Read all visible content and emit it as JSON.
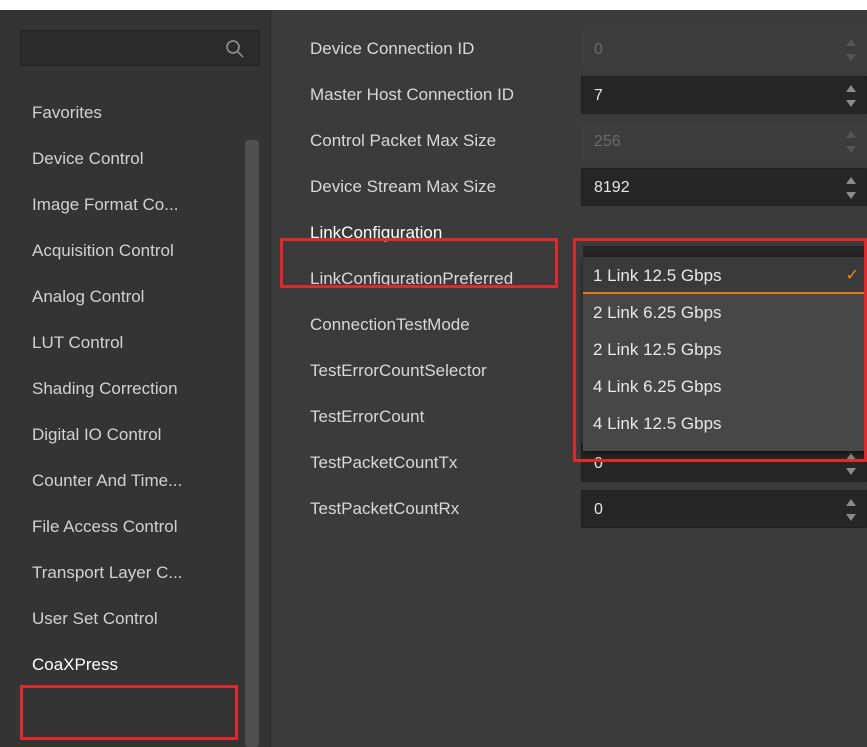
{
  "search": {
    "placeholder": ""
  },
  "sidebar": {
    "items": [
      {
        "label": "Favorites"
      },
      {
        "label": "Device Control"
      },
      {
        "label": "Image Format Co..."
      },
      {
        "label": "Acquisition Control"
      },
      {
        "label": "Analog Control"
      },
      {
        "label": "LUT Control"
      },
      {
        "label": "Shading Correction"
      },
      {
        "label": "Digital IO Control"
      },
      {
        "label": "Counter And Time..."
      },
      {
        "label": "File Access Control"
      },
      {
        "label": "Transport Layer C..."
      },
      {
        "label": "User Set Control"
      },
      {
        "label": "CoaXPress"
      }
    ],
    "selected": "CoaXPress"
  },
  "properties": [
    {
      "label": "Device Connection ID",
      "value": "0",
      "disabled": true
    },
    {
      "label": "Master Host Connection ID",
      "value": "7",
      "disabled": false
    },
    {
      "label": "Control Packet Max Size",
      "value": "256",
      "disabled": true
    },
    {
      "label": "Device Stream Max Size",
      "value": "8192",
      "disabled": false
    },
    {
      "label": "LinkConfiguration"
    },
    {
      "label": "LinkConfigurationPreferred"
    },
    {
      "label": "ConnectionTestMode"
    },
    {
      "label": "TestErrorCountSelector"
    },
    {
      "label": "TestErrorCount"
    },
    {
      "label": "TestPacketCountTx",
      "value": "0",
      "disabled": false
    },
    {
      "label": "TestPacketCountRx",
      "value": "0",
      "disabled": false
    }
  ],
  "link_dropdown": {
    "options": [
      "1 Link 12.5 Gbps",
      "2 Link 6.25 Gbps",
      "2 Link 12.5 Gbps",
      "4 Link 6.25 Gbps",
      "4 Link 12.5 Gbps"
    ],
    "selected": "1 Link 12.5 Gbps",
    "check_icon": "✓"
  },
  "colors": {
    "highlight": "#e0282d",
    "accent": "#f08a24",
    "background": "#3b3b3b",
    "sidebar": "#343434"
  }
}
